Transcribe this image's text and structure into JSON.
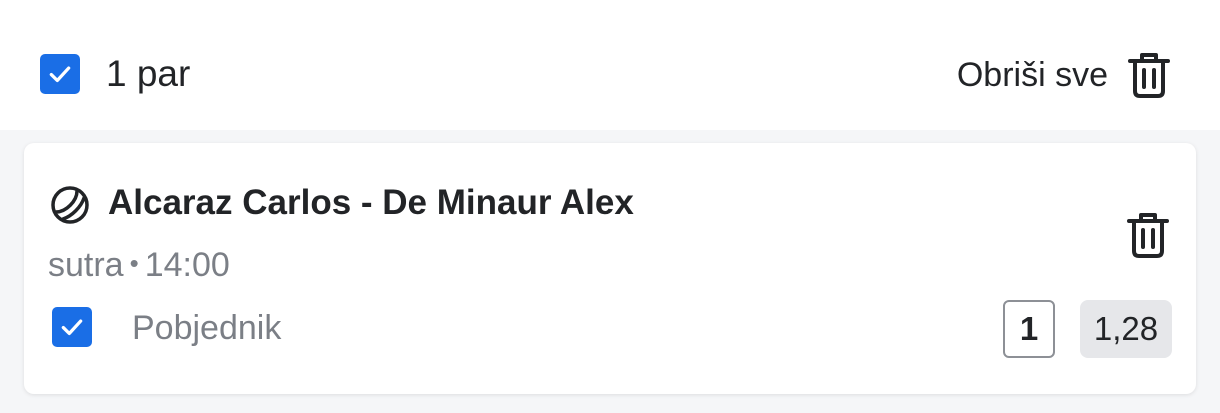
{
  "header": {
    "select_all_checked": true,
    "pair_count": "1 par",
    "delete_all_label": "Obriši sve",
    "delete_icon": "trash-icon"
  },
  "bet": {
    "sport_icon": "tennis-ball-icon",
    "match_title": "Alcaraz Carlos - De Minaur Alex",
    "day": "sutra",
    "separator": "•",
    "time": "14:00",
    "selected": true,
    "market": "Pobjednik",
    "outcome": "1",
    "odds": "1,28"
  },
  "colors": {
    "accent": "#1a6ee6",
    "text_primary": "#222427",
    "text_secondary": "#7b7f86",
    "odds_background": "#e6e7ea",
    "page_background": "#f5f6f8"
  }
}
